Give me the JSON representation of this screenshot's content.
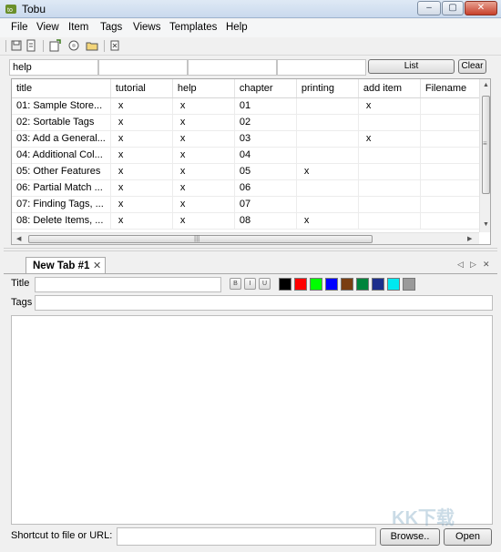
{
  "window": {
    "title": "Tobu",
    "controls": [
      "–",
      "▢",
      "✕"
    ]
  },
  "menu": [
    "File",
    "View",
    "Item",
    "Tags",
    "Views",
    "Templates",
    "Help"
  ],
  "toolbar": {
    "icons": [
      "save-icon",
      "open-icon",
      "new-item-icon",
      "copy-icon",
      "folder-icon",
      "delete-icon"
    ]
  },
  "filter": {
    "fields": [
      "help",
      "",
      "",
      ""
    ],
    "list_label": "List",
    "clear_label": "Clear"
  },
  "table": {
    "columns": [
      "title",
      "tutorial",
      "help",
      "chapter",
      "printing",
      "add item",
      "Filename"
    ],
    "rows": [
      [
        "01: Sample Store...",
        "x",
        "x",
        "01",
        "",
        "x",
        ""
      ],
      [
        "02: Sortable Tags",
        "x",
        "x",
        "02",
        "",
        "",
        ""
      ],
      [
        "03: Add a General...",
        "x",
        "x",
        "03",
        "",
        "x",
        ""
      ],
      [
        "04: Additional Col...",
        "x",
        "x",
        "04",
        "",
        "",
        ""
      ],
      [
        "05: Other Features",
        "x",
        "x",
        "05",
        "x",
        "",
        ""
      ],
      [
        "06: Partial Match ...",
        "x",
        "x",
        "06",
        "",
        "",
        ""
      ],
      [
        "07: Finding Tags, ...",
        "x",
        "x",
        "07",
        "",
        "",
        ""
      ],
      [
        "08: Delete Items, ...",
        "x",
        "x",
        "08",
        "x",
        "",
        ""
      ]
    ]
  },
  "tabs": {
    "active": "New Tab #1",
    "close": "✕",
    "nav_left": "◁",
    "nav_right": "▷",
    "nav_close": "✕"
  },
  "editor": {
    "title_label": "Title",
    "tags_label": "Tags",
    "title_value": "",
    "tags_value": "",
    "format_buttons": [
      "B",
      "I",
      "U"
    ],
    "colors": [
      "#000000",
      "#ff0000",
      "#00ff00",
      "#0000ff",
      "#7a3e12",
      "#00843d",
      "#1d2f8c",
      "#00e8f0",
      "#9a9a9a"
    ]
  },
  "bottom": {
    "shortcut_label": "Shortcut to file or URL:",
    "url_value": "",
    "browse_label": "Browse..",
    "open_label": "Open"
  },
  "watermark": "KK下载"
}
